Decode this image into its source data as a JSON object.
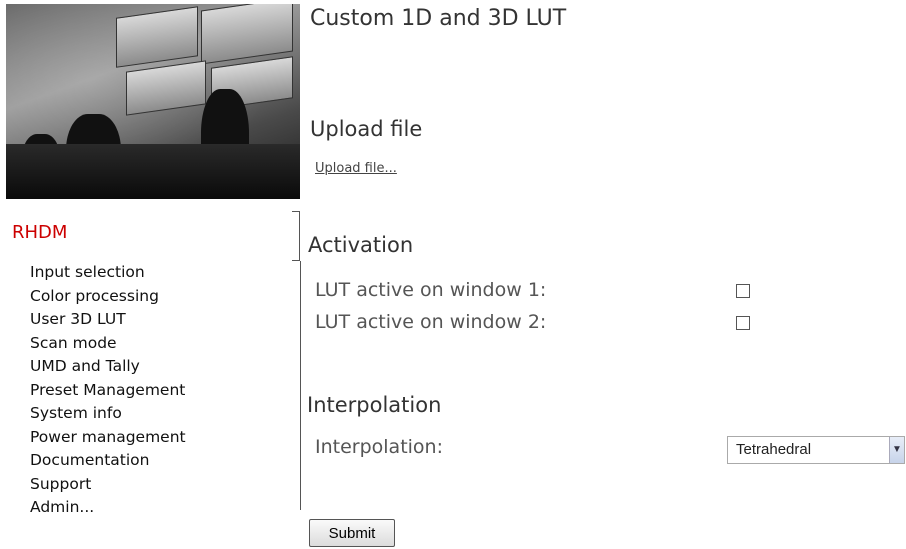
{
  "header": {
    "image_alt": "control room photo"
  },
  "sidebar": {
    "title": "RHDM",
    "items": [
      {
        "label": "Input selection"
      },
      {
        "label": "Color processing"
      },
      {
        "label": "User 3D LUT"
      },
      {
        "label": "Scan mode"
      },
      {
        "label": "UMD and Tally"
      },
      {
        "label": "Preset Management"
      },
      {
        "label": "System info"
      },
      {
        "label": "Power management"
      },
      {
        "label": "Documentation"
      },
      {
        "label": "Support"
      },
      {
        "label": "Admin..."
      }
    ]
  },
  "main": {
    "title": "Custom 1D and 3D LUT",
    "upload": {
      "heading": "Upload file",
      "link": "Upload file..."
    },
    "activation": {
      "heading": "Activation",
      "rows": [
        {
          "label": "LUT active on window 1:",
          "checked": false
        },
        {
          "label": "LUT active on window 2:",
          "checked": false
        }
      ]
    },
    "interpolation": {
      "heading": "Interpolation",
      "label": "Interpolation:",
      "selected": "Tetrahedral"
    },
    "submit_label": "Submit"
  },
  "colors": {
    "sidebar_title": "#cc0000"
  }
}
